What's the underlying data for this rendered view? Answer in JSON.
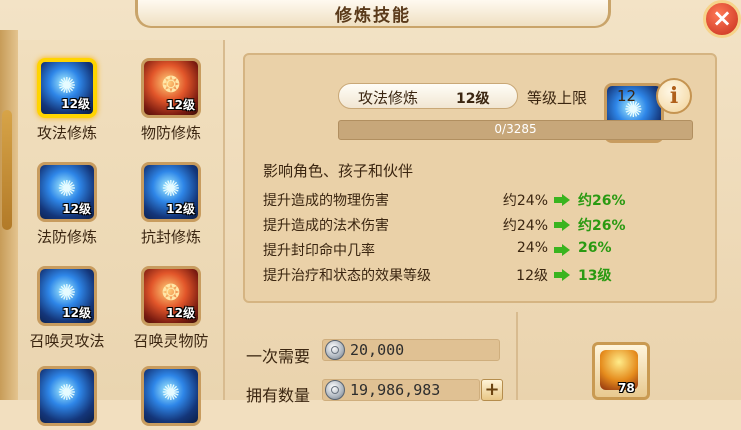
{
  "window": {
    "title": "修炼技能"
  },
  "skills": [
    {
      "name": "攻法修炼",
      "level": "12级",
      "color": "blue",
      "selected": true,
      "icon": "magic-swirl-icon"
    },
    {
      "name": "物防修炼",
      "level": "12级",
      "color": "red",
      "selected": false,
      "icon": "shield-beast-icon"
    },
    {
      "name": "法防修炼",
      "level": "12级",
      "color": "blue",
      "selected": false,
      "icon": "magic-shield-icon"
    },
    {
      "name": "抗封修炼",
      "level": "12级",
      "color": "blue",
      "selected": false,
      "icon": "seal-resist-icon"
    },
    {
      "name": "召唤灵攻法",
      "level": "12级",
      "color": "blue",
      "selected": false,
      "icon": "summon-spirit-icon"
    },
    {
      "name": "召唤灵物防",
      "level": "12级",
      "color": "red",
      "selected": false,
      "icon": "summon-guard-icon"
    },
    {
      "name": "",
      "level": "",
      "color": "blue",
      "selected": false,
      "icon": "summon-spirit-icon"
    },
    {
      "name": "",
      "level": "",
      "color": "blue",
      "selected": false,
      "icon": "summon-spirit-icon"
    }
  ],
  "detail": {
    "skill_name": "攻法修炼",
    "skill_level": "12级",
    "cap_label": "等级上限",
    "cap_value": "12",
    "info_button": "i",
    "progress_text": "0/3285",
    "progress_fraction": 0.0,
    "affects": "影响角色、孩子和伙伴",
    "rows": [
      {
        "label": "提升造成的物理伤害",
        "current": "约24%",
        "next": "约26%"
      },
      {
        "label": "提升造成的法术伤害",
        "current": "约24%",
        "next": "约26%"
      },
      {
        "label": "提升封印命中几率",
        "current": "24%",
        "next": "26%"
      },
      {
        "label": "提升治疗和状态的效果等级",
        "current": "12级",
        "next": "13级"
      }
    ]
  },
  "cost": {
    "label": "一次需要",
    "value": "20,000",
    "own_label": "拥有数量",
    "own_value": "19,986,983",
    "plus": "+"
  },
  "item": {
    "count": "78",
    "icon": "treasure-bag-icon"
  },
  "close_button": "×"
}
